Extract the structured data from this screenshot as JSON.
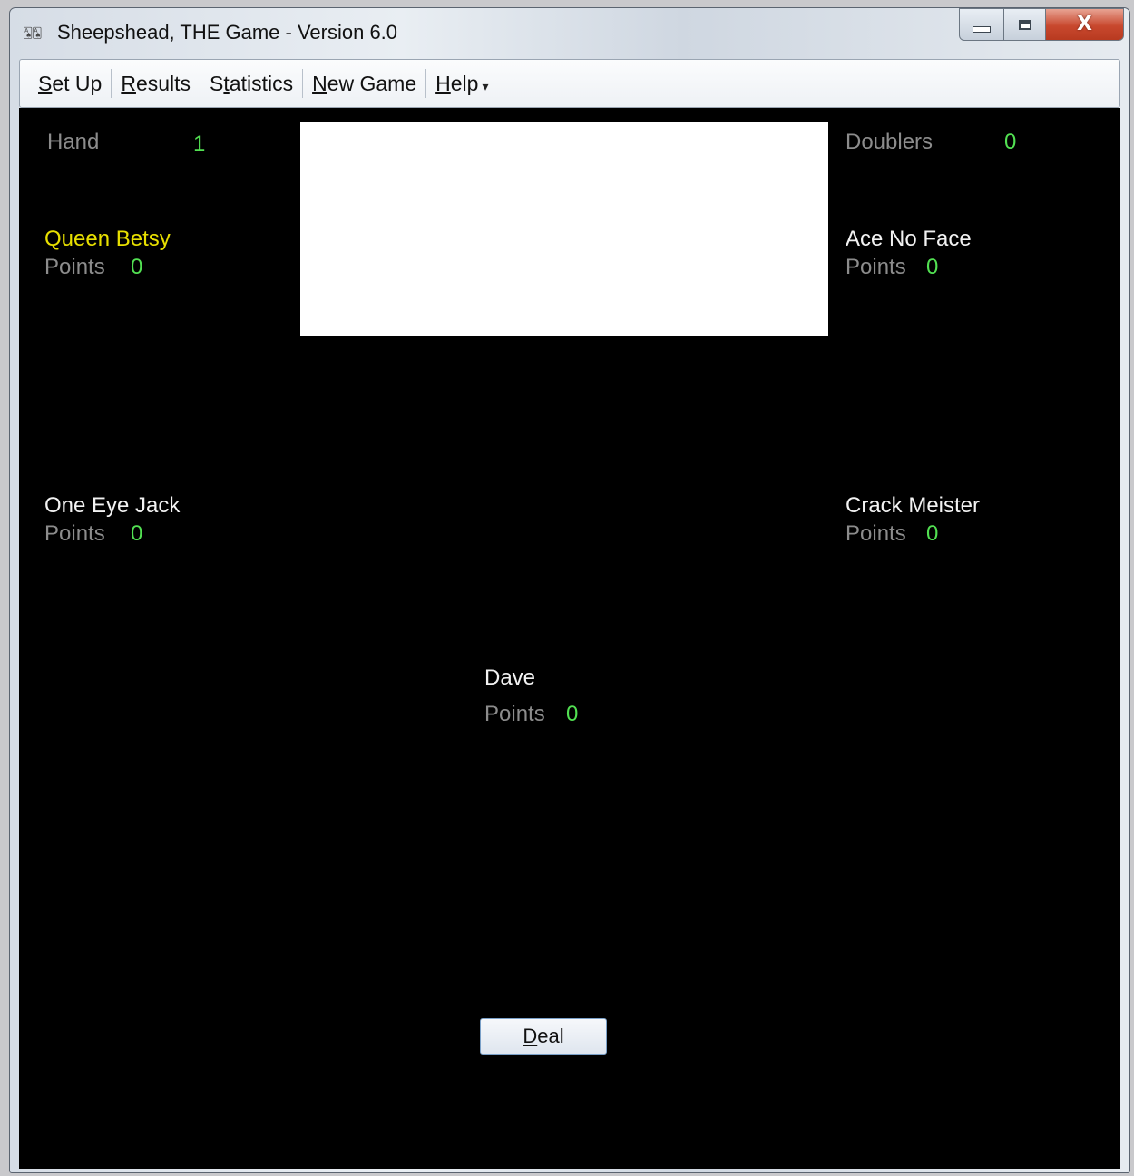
{
  "window": {
    "title": "Sheepshead, THE Game - Version 6.0",
    "icon": "cards-app-icon",
    "controls": {
      "minimize_icon": "minimize-icon",
      "maximize_icon": "maximize-icon",
      "close_icon": "close-icon",
      "close_glyph": "X"
    }
  },
  "menu": {
    "items": [
      {
        "label": "Set Up",
        "accel": "S"
      },
      {
        "label": "Results",
        "accel": "R"
      },
      {
        "label": "Statistics",
        "accel": "t"
      },
      {
        "label": "New Game",
        "accel": "N"
      },
      {
        "label": "Help",
        "accel": "H"
      }
    ],
    "help_arrow": "▾"
  },
  "game": {
    "hand_label": "Hand",
    "hand_value": "1",
    "doublers_label": "Doublers",
    "doublers_value": "0",
    "points_label": "Points",
    "players": {
      "top_left": {
        "name": "Queen Betsy",
        "points": "0",
        "highlight": "yellow"
      },
      "top_right": {
        "name": "Ace No Face",
        "points": "0"
      },
      "mid_left": {
        "name": "One Eye Jack",
        "points": "0"
      },
      "mid_right": {
        "name": "Crack Meister",
        "points": "0"
      },
      "bottom": {
        "name": "Dave",
        "points": "0"
      }
    },
    "deal_button": "Deal"
  },
  "colors": {
    "background": "#000000",
    "label_grey": "#8c8c8c",
    "value_green": "#52e052",
    "name_white": "#f2f2f2",
    "active_yellow": "#e8e000"
  }
}
